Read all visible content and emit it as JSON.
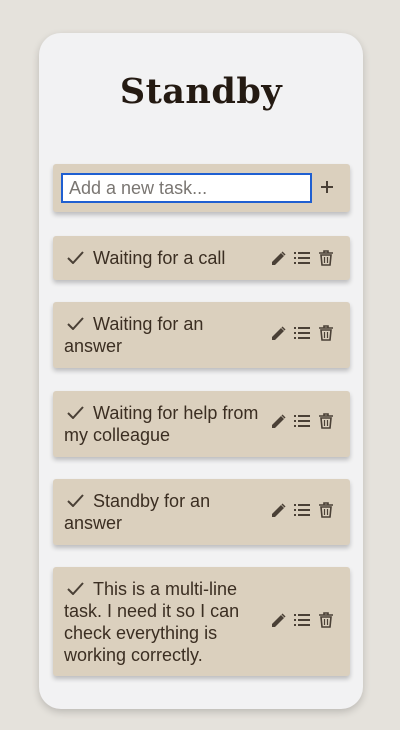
{
  "app": {
    "title": "Standby"
  },
  "add_task": {
    "placeholder": "Add a new task...",
    "value": ""
  },
  "tasks": [
    {
      "text": "Waiting for a call",
      "done_icon": "check-icon",
      "actions": [
        "pencil-icon",
        "list-icon",
        "trash-icon"
      ]
    },
    {
      "text": "Waiting for an answer",
      "done_icon": "check-icon",
      "actions": [
        "pencil-icon",
        "list-icon",
        "trash-icon"
      ]
    },
    {
      "text": "Waiting for help from my colleague",
      "done_icon": "check-icon",
      "actions": [
        "pencil-icon",
        "list-icon",
        "trash-icon"
      ]
    },
    {
      "text": "Standby for an answer",
      "done_icon": "check-icon",
      "actions": [
        "pencil-icon",
        "list-icon",
        "trash-icon"
      ]
    },
    {
      "text": "This is a multi-line task. I need it so I can check everything is working correctly.",
      "done_icon": "check-icon",
      "actions": [
        "pencil-icon",
        "list-icon",
        "trash-icon"
      ]
    }
  ],
  "colors": {
    "background": "#e5e2dc",
    "card": "#f2f2f3",
    "task_tile": "#dbd0be",
    "text": "#3b2e22",
    "title": "#241a12",
    "input_focus": "#1f5fd1"
  }
}
